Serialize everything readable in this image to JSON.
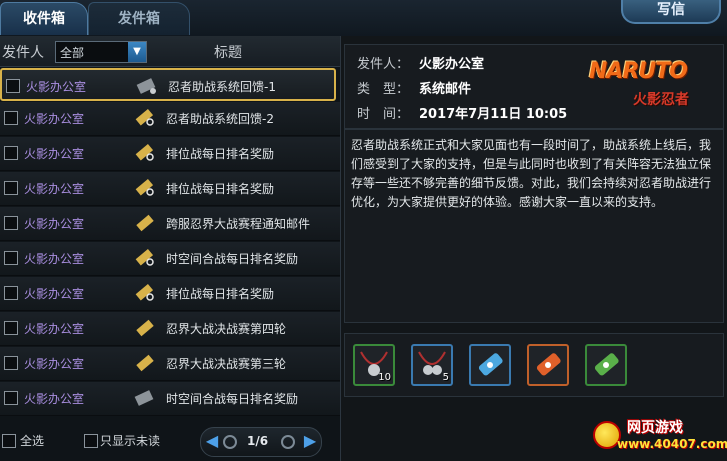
{
  "tabs": {
    "inbox": "收件箱",
    "outbox": "发件箱",
    "write": "写信"
  },
  "list_header": {
    "sender_label": "发件人",
    "filter_value": "全部",
    "title_label": "标题"
  },
  "mails": [
    {
      "sender": "火影办公室",
      "subject": "忍者助战系统回馈-1",
      "icon": "opened-scroll-icon"
    },
    {
      "sender": "火影办公室",
      "subject": "忍者助战系统回馈-2",
      "icon": "scroll-attachment-icon"
    },
    {
      "sender": "火影办公室",
      "subject": "排位战每日排名奖励",
      "icon": "scroll-attachment-icon"
    },
    {
      "sender": "火影办公室",
      "subject": "排位战每日排名奖励",
      "icon": "scroll-attachment-icon"
    },
    {
      "sender": "火影办公室",
      "subject": "跨服忍界大战赛程通知邮件",
      "icon": "scroll-icon"
    },
    {
      "sender": "火影办公室",
      "subject": "时空间合战每日排名奖励",
      "icon": "scroll-attachment-icon"
    },
    {
      "sender": "火影办公室",
      "subject": "排位战每日排名奖励",
      "icon": "scroll-attachment-icon"
    },
    {
      "sender": "火影办公室",
      "subject": "忍界大战决战赛第四轮",
      "icon": "scroll-icon"
    },
    {
      "sender": "火影办公室",
      "subject": "忍界大战决战赛第三轮",
      "icon": "scroll-icon"
    },
    {
      "sender": "火影办公室",
      "subject": "时空间合战每日排名奖励",
      "icon": "opened-scroll-icon"
    }
  ],
  "list_footer": {
    "select_all": "全选",
    "unread_only": "只显示未读",
    "page": "1/6"
  },
  "detail": {
    "sender_key": "发件人：",
    "sender_val": "火影办公室",
    "type_key": "类　型：",
    "type_val": "系统邮件",
    "time_key": "时　间：",
    "time_val": "2017年7月11日 10:05",
    "logo_text": "NARUTO",
    "logo_sub": "火影忍者",
    "body": "忍者助战系统正式和大家见面也有一段时间了，助战系统上线后，我们感受到了大家的支持，但是与此同时也收到了有关阵容无法独立保存等一些还不够完善的细节反馈。对此，我们会持续对忍者助战进行优化，为大家提供更好的体验。感谢大家一直以来的支持。"
  },
  "attachments": [
    {
      "name": "bell-necklace-red",
      "qty": "10",
      "border": "#3a8a3a"
    },
    {
      "name": "bell-necklace-blue",
      "qty": "5",
      "border": "#3a7ab0"
    },
    {
      "name": "scroll-blue",
      "qty": "",
      "border": "#3a7ab0"
    },
    {
      "name": "scroll-orange",
      "qty": "",
      "border": "#c0602a"
    },
    {
      "name": "scroll-green",
      "qty": "",
      "border": "#3a8a3a"
    }
  ],
  "watermark": {
    "top": "网页游戏",
    "bottom": "www.40407.com"
  }
}
